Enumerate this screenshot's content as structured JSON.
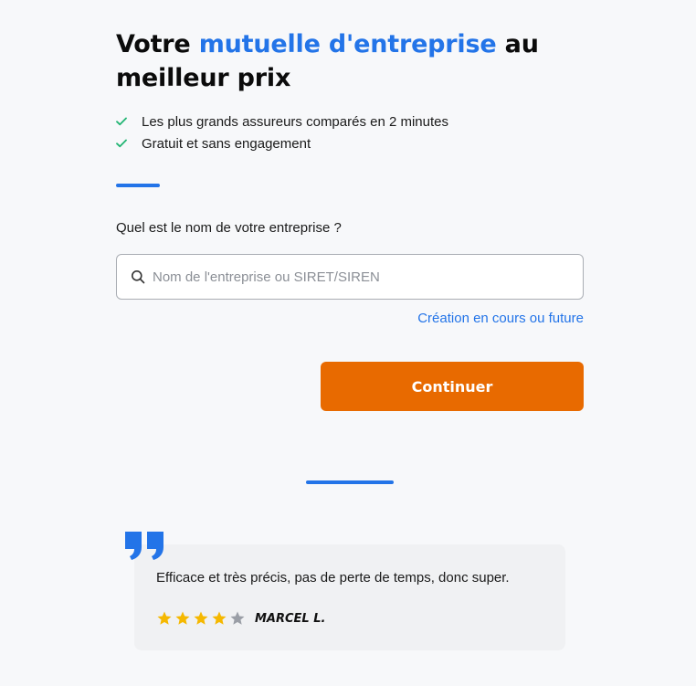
{
  "headline": {
    "before": "Votre ",
    "accent": "mutuelle d'entreprise",
    "after": " au meilleur prix"
  },
  "benefits": [
    {
      "text": "Les plus grands assureurs comparés en 2 minutes",
      "icon": "check-icon"
    },
    {
      "text": "Gratuit et sans engagement",
      "icon": "check-icon"
    }
  ],
  "form": {
    "question": "Quel est le nom de votre entreprise ?",
    "search_placeholder": "Nom de l'entreprise ou SIRET/SIREN",
    "search_value": "",
    "search_icon": "search-icon",
    "creation_link": "Création en cours ou future",
    "continue_label": "Continuer"
  },
  "review": {
    "quote_icon": "quote-icon",
    "text": "Efficace et très précis, pas de perte de temps, donc super.",
    "rating": 4,
    "max_rating": 5,
    "author": "MARCEL L."
  },
  "colors": {
    "accent": "#2374e8",
    "button": "#e86a00",
    "check": "#22b573",
    "star_filled": "#f5b800",
    "star_empty": "#9a9ea6",
    "background": "#f7f8fa"
  }
}
